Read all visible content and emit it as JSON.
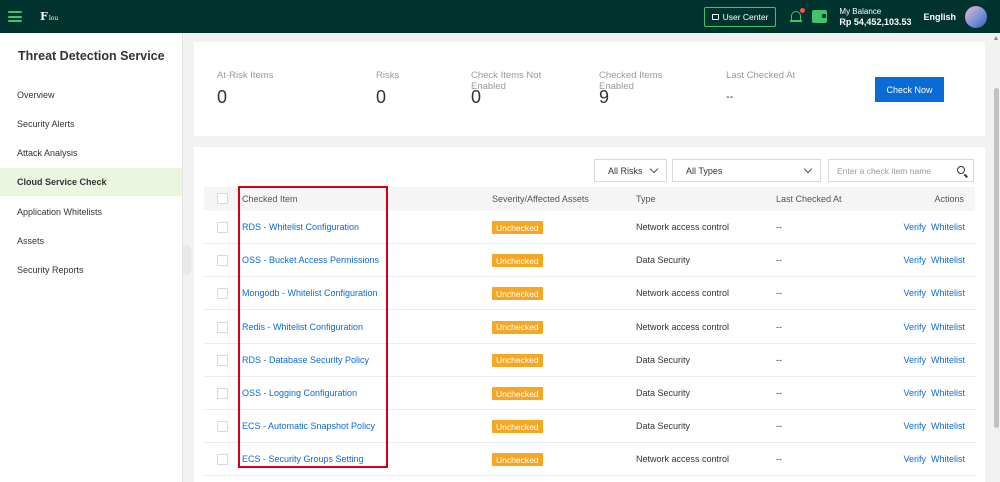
{
  "header": {
    "logo_text": "F",
    "logo_sub": "lou",
    "user_center": "User Center",
    "balance_label": "My Balance",
    "balance_value": "Rp 54,452,103.53",
    "language": "English",
    "accent": "#41c36d",
    "bg": "#00332e"
  },
  "sidebar": {
    "title": "Threat Detection Service",
    "items": [
      {
        "label": "Overview",
        "active": false
      },
      {
        "label": "Security Alerts",
        "active": false
      },
      {
        "label": "Attack Analysis",
        "active": false
      },
      {
        "label": "Cloud Service Check",
        "active": true
      },
      {
        "label": "Application Whitelists",
        "active": false
      },
      {
        "label": "Assets",
        "active": false
      },
      {
        "label": "Security Reports",
        "active": false
      }
    ]
  },
  "stats": [
    {
      "label": "At-Risk Items",
      "value": "0"
    },
    {
      "label": "Risks",
      "value": "0"
    },
    {
      "label": "Check Items Not Enabled",
      "value": "0"
    },
    {
      "label": "Checked Items Enabled",
      "value": "9"
    },
    {
      "label": "Last Checked At",
      "value": "--"
    }
  ],
  "check_now": "Check Now",
  "filters": {
    "risk": "All Risks",
    "type": "All Types",
    "search_placeholder": "Enter a check item name"
  },
  "table": {
    "columns": [
      "Checked Item",
      "Severity/Affected Assets",
      "Type",
      "Last Checked At",
      "Actions"
    ],
    "action_verify": "Verify",
    "action_whitelist": "Whitelist",
    "rows": [
      {
        "item": "RDS - Whitelist Configuration",
        "severity": "Unchecked",
        "type": "Network access control",
        "last": "--"
      },
      {
        "item": "OSS - Bucket Access Permissions",
        "severity": "Unchecked",
        "type": "Data Security",
        "last": "--"
      },
      {
        "item": "Mongodb - Whitelist Configuration",
        "severity": "Unchecked",
        "type": "Network access control",
        "last": "--"
      },
      {
        "item": "Redis - Whitelist Configuration",
        "severity": "Unchecked",
        "type": "Network access control",
        "last": "--"
      },
      {
        "item": "RDS - Database Security Policy",
        "severity": "Unchecked",
        "type": "Data Security",
        "last": "--"
      },
      {
        "item": "OSS - Logging Configuration",
        "severity": "Unchecked",
        "type": "Data Security",
        "last": "--"
      },
      {
        "item": "ECS - Automatic Snapshot Policy",
        "severity": "Unchecked",
        "type": "Data Security",
        "last": "--"
      },
      {
        "item": "ECS - Security Groups Setting",
        "severity": "Unchecked",
        "type": "Network access control",
        "last": "--"
      }
    ],
    "badge_color": "#f5a623",
    "link_color": "#0b6bd6"
  }
}
